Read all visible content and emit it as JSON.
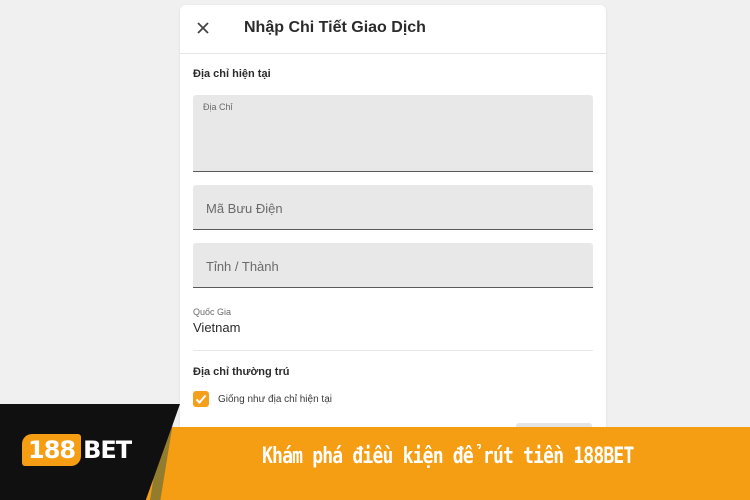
{
  "dialog": {
    "title": "Nhập Chi Tiết Giao Dịch",
    "close_icon": "close-icon"
  },
  "current_address": {
    "section_label": "Địa chỉ hiện tại",
    "address_label": "Địa Chỉ",
    "postal_code_placeholder": "Mã Bưu Điện",
    "province_city_placeholder": "Tỉnh / Thành",
    "country_label": "Quốc Gia",
    "country_value": "Vietnam"
  },
  "permanent_address": {
    "section_label": "Địa chỉ thường trú",
    "same_as_current_label": "Giống như địa chỉ hiện tại",
    "same_as_current_checked": true
  },
  "banner": {
    "logo_number": "188",
    "logo_text": "BET",
    "headline": "Khám phá điều kiện để rút tiền 188BET"
  },
  "colors": {
    "accent": "#f59d13",
    "banner_dark": "#101010"
  }
}
